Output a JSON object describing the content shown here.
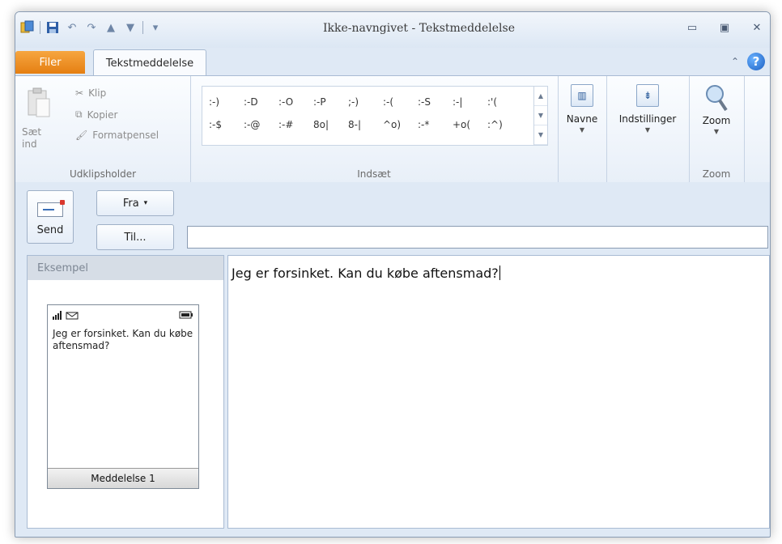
{
  "window": {
    "title": "Ikke-navngivet - Tekstmeddelelse",
    "quick_access_icons": [
      "app-icon",
      "save-icon",
      "undo-icon",
      "redo-icon",
      "up-arrow-icon",
      "down-arrow-icon",
      "customize-icon"
    ],
    "controls": [
      "minimize-icon",
      "restore-icon",
      "close-icon"
    ]
  },
  "tabs": {
    "file": "Filer",
    "active": "Tekstmeddelelse"
  },
  "ribbon": {
    "clipboard": {
      "paste_line1": "Sæt",
      "paste_line2": "ind",
      "cut": "Klip",
      "copy": "Kopier",
      "format_painter": "Formatpensel",
      "group_label": "Udklipsholder"
    },
    "insert": {
      "emoticons": [
        ":-)",
        ":-D",
        ":-O",
        ":-P",
        ";-)",
        ":-(",
        ":-S",
        ":-|",
        ":'(",
        ":-$",
        ":-@",
        ":-#",
        "8o|",
        "8-|",
        "^o)",
        ":-*",
        "+o(",
        ":^)"
      ],
      "group_label": "Indsæt"
    },
    "names": {
      "label": "Navne"
    },
    "settings": {
      "label": "Indstillinger"
    },
    "zoom": {
      "label": "Zoom",
      "group_label": "Zoom"
    }
  },
  "header": {
    "send_label": "Send",
    "from_label": "Fra",
    "to_label": "Til...",
    "to_value": ""
  },
  "preview": {
    "title": "Eksempel",
    "message": "Jeg er forsinket. Kan du købe aftensmad?",
    "footer": "Meddelelse 1"
  },
  "compose": {
    "text": "Jeg er forsinket. Kan du købe aftensmad?"
  },
  "colors": {
    "file_tab": "#e98a1c",
    "window_bg": "#dfe9f5",
    "help_blue": "#1c5fc2"
  }
}
